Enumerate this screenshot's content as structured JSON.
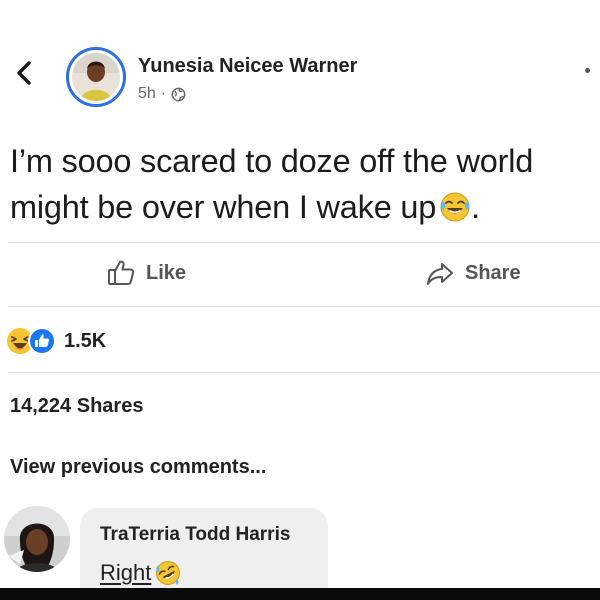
{
  "post": {
    "author": "Yunesia Neicee Warner",
    "time": "5h",
    "meta_separator": "·",
    "privacy_icon": "globe-icon",
    "text": "I’m sooo scared to doze off the world might be over when I wake up",
    "trailing_emoji": "tears-of-joy-emoji",
    "trailing_punctuation": "."
  },
  "actions": {
    "like_label": "Like",
    "share_label": "Share"
  },
  "reactions": {
    "icons": [
      "haha-reaction-icon",
      "like-reaction-icon"
    ],
    "count": "1.5K"
  },
  "shares": {
    "label": "14,224 Shares"
  },
  "comments": {
    "view_previous_label": "View previous comments...",
    "items": [
      {
        "name": "TraTerria Todd Harris",
        "text": "Right",
        "emoji": "rofl-emoji"
      }
    ]
  },
  "colors": {
    "avatar_ring": "#2f6fe0",
    "like_reaction": "#1877f2",
    "haha_reaction": "#f7c531",
    "text_primary": "#1c1c1c",
    "text_secondary": "#666666",
    "comment_bubble": "#efefef"
  }
}
